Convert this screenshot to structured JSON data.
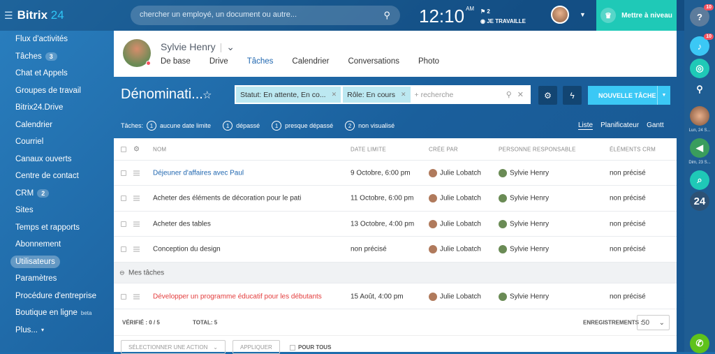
{
  "app": {
    "logo_text": "Bitrix",
    "logo_num": "24"
  },
  "header": {
    "search_placeholder": "chercher un employé, un document ou autre...",
    "time": "12:10",
    "ampm": "AM",
    "flag_count": "2",
    "work_status": "JE TRAVAILLE",
    "upgrade_label": "Mettre à niveau"
  },
  "sidebar": {
    "items": [
      {
        "label": "Flux d'activités"
      },
      {
        "label": "Tâches",
        "count": "3"
      },
      {
        "label": "Chat et Appels"
      },
      {
        "label": "Groupes de travail"
      },
      {
        "label": "Bitrix24.Drive"
      },
      {
        "label": "Calendrier"
      },
      {
        "label": "Courriel"
      },
      {
        "label": "Canaux ouverts"
      },
      {
        "label": "Centre de contact"
      },
      {
        "label": "CRM",
        "count": "2"
      },
      {
        "label": "Sites"
      },
      {
        "label": "Temps et rapports"
      },
      {
        "label": "Abonnement"
      },
      {
        "label": "Utilisateurs"
      },
      {
        "label": "Paramètres"
      },
      {
        "label": "Procédure d'entreprise"
      },
      {
        "label": "Boutique en ligne",
        "sup": "beta"
      },
      {
        "label": "Plus...",
        "caret": "▾"
      }
    ]
  },
  "rightbar": {
    "help_badge": "10",
    "notif_badge": "10",
    "date1": "Lun, 24 S...",
    "date2": "Dim, 23 S...",
    "b24": "24"
  },
  "profile": {
    "name": "Sylvie Henry",
    "tabs": [
      "De base",
      "Drive",
      "Tâches",
      "Calendrier",
      "Conversations",
      "Photo"
    ]
  },
  "page": {
    "title": "Dénominati...",
    "filter_chip1": "Statut: En attente, En co...",
    "filter_chip2": "Rôle: En cours",
    "filter_placeholder": "+ recherche",
    "new_task": "NOUVELLE TÂCHE"
  },
  "counters": {
    "prefix": "Tâches:",
    "items": [
      {
        "n": "1",
        "label": "aucune date limite"
      },
      {
        "n": "1",
        "label": "dépassé"
      },
      {
        "n": "1",
        "label": "presque dépassé"
      },
      {
        "n": "2",
        "label": "non visualisé"
      }
    ]
  },
  "views": [
    "Liste",
    "Planificateur",
    "Gantt"
  ],
  "table": {
    "headers": {
      "name": "NOM",
      "deadline": "DATE LIMITE",
      "created_by": "CRÉE PAR",
      "responsible": "PERSONNE RESPONSABLE",
      "crm": "ÉLÉMENTS CRM"
    },
    "rows": [
      {
        "name": "Déjeuner d'affaires avec Paul",
        "deadline": "9 Octobre, 6:00 pm",
        "created_by": "Julie Lobatch",
        "responsible": "Sylvie Henry",
        "crm": "non précisé"
      },
      {
        "name": "Acheter des éléments de décoration pour le pati",
        "deadline": "11 Octobre, 6:00 pm",
        "created_by": "Julie Lobatch",
        "responsible": "Sylvie Henry",
        "crm": "non précisé"
      },
      {
        "name": "Acheter des tables",
        "deadline": "13 Octobre, 4:00 pm",
        "created_by": "Julie Lobatch",
        "responsible": "Sylvie Henry",
        "crm": "non précisé"
      },
      {
        "name": "Conception du design",
        "deadline": "non précisé",
        "created_by": "Julie Lobatch",
        "responsible": "Sylvie Henry",
        "crm": "non précisé"
      }
    ],
    "group_label": "Mes tâches",
    "group_rows": [
      {
        "name": "Développer un programme éducatif pour les débutants",
        "deadline": "15 Août, 4:00 pm",
        "created_by": "Julie Lobatch",
        "responsible": "Sylvie Henry",
        "crm": "non précisé"
      }
    ],
    "footer": {
      "verified": "VÉRIFIÉ : 0 / 5",
      "total": "TOTAL: 5",
      "records_label": "ENREGISTREMENTS :",
      "per_page": "50"
    }
  },
  "actions": {
    "select_action": "SÉLECTIONNER UNE ACTION",
    "apply": "APPLIQUER",
    "for_all": "POUR TOUS"
  }
}
